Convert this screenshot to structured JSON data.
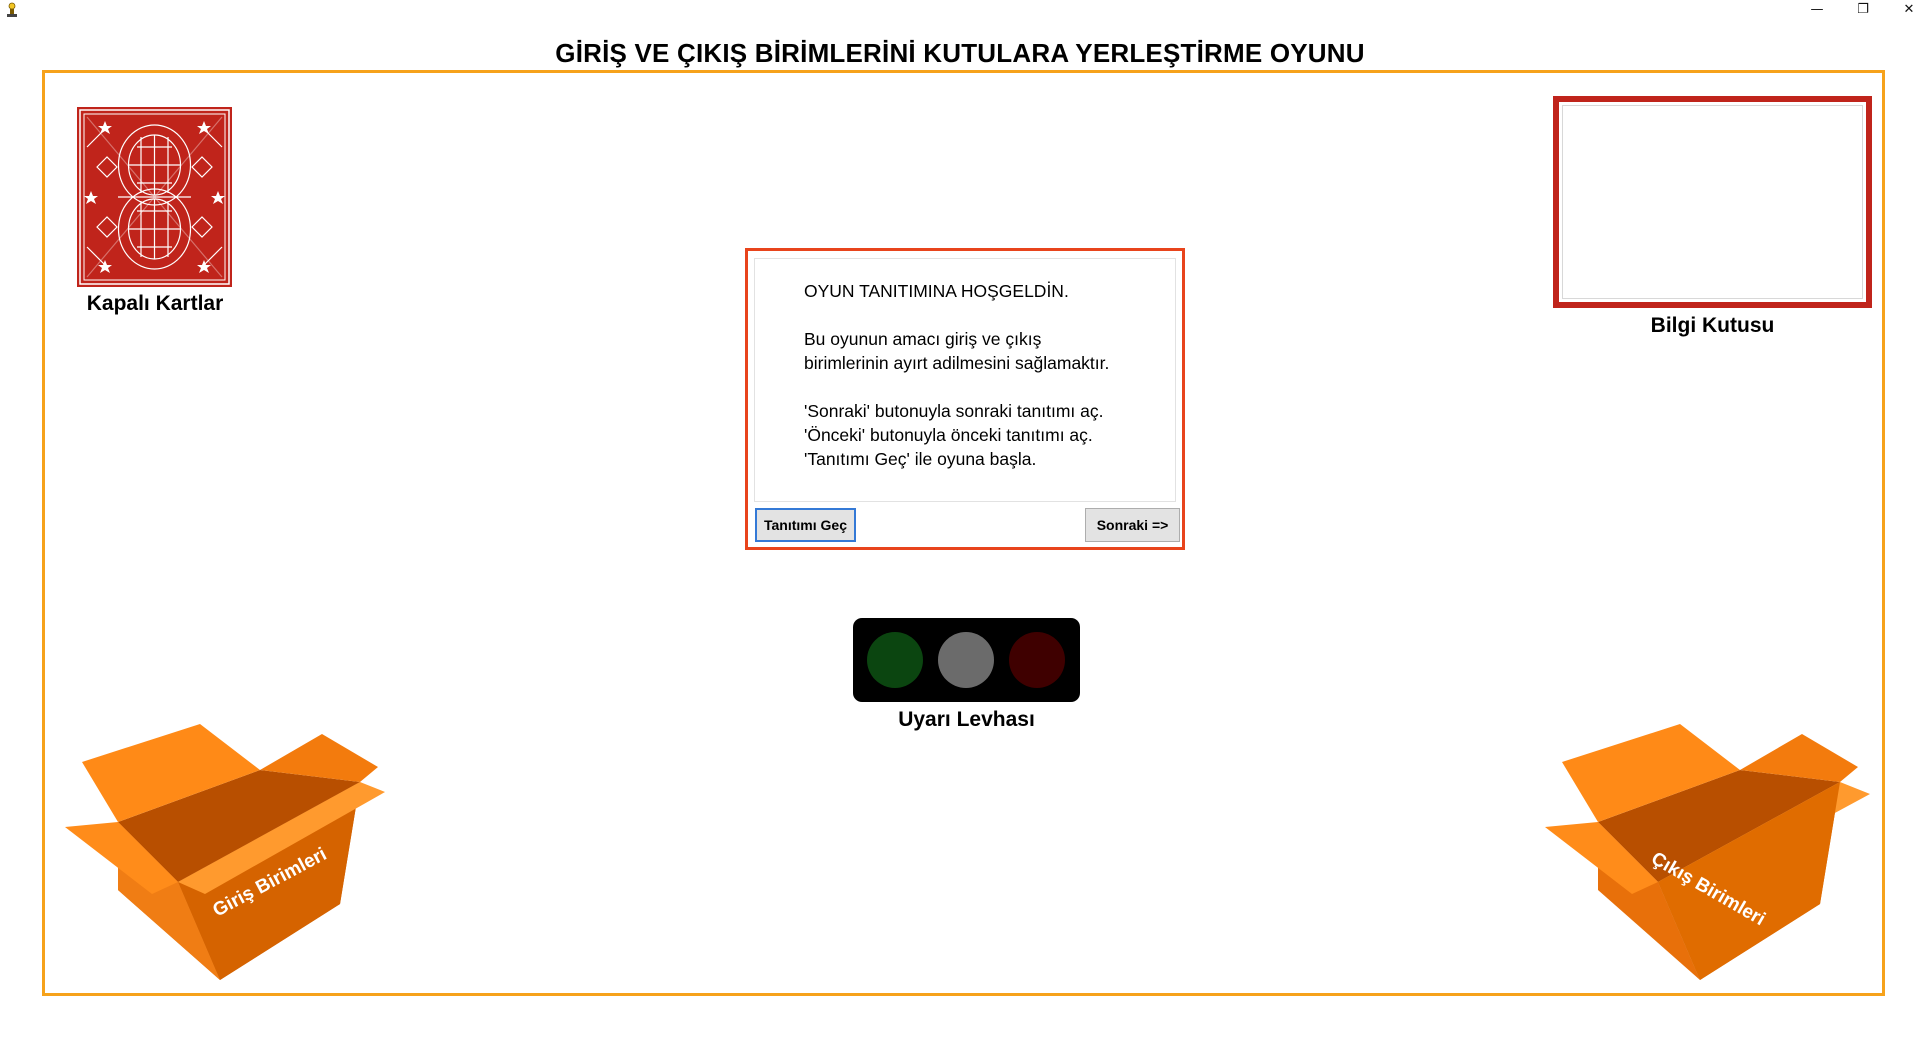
{
  "window": {
    "minimize_glyph": "—",
    "restore_glyph": "❐",
    "close_glyph": "✕"
  },
  "title": "GİRİŞ VE ÇIKIŞ BİRİMLERİNİ KUTULARA YERLEŞTİRME OYUNU",
  "deck": {
    "label": "Kapalı Kartlar",
    "color": "#c0241b"
  },
  "info_box": {
    "label": "Bilgi Kutusu",
    "color": "#c0241b"
  },
  "dialog": {
    "line1": "OYUN TANITIMINA HOŞGELDİN.",
    "line2": "Bu oyunun amacı giriş ve çıkış",
    "line3": "birimlerinin ayırt adilmesini sağlamaktır.",
    "line4": "'Sonraki' butonuyla sonraki tanıtımı aç.",
    "line5": "'Önceki' butonuyla önceki tanıtımı aç.",
    "line6": "'Tanıtımı Geç' ile oyuna başla.",
    "skip_button": "Tanıtımı Geç",
    "next_button": "Sonraki =>",
    "border_color": "#e8441c"
  },
  "traffic_light": {
    "label": "Uyarı Levhası",
    "lamps": [
      "green",
      "gray",
      "red"
    ]
  },
  "boxes": {
    "input": "Giriş Birimleri",
    "output": "Çıkış Birimleri",
    "color": "#f07d14"
  },
  "board_border_color": "#f6a21b"
}
